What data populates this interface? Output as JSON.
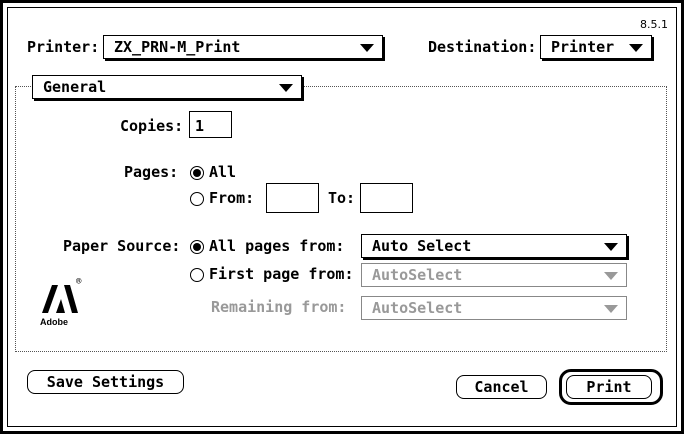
{
  "version": "8.5.1",
  "printer": {
    "label": "Printer:",
    "value": "ZX_PRN-M_Print"
  },
  "destination": {
    "label": "Destination:",
    "value": "Printer"
  },
  "panel": {
    "value": "General"
  },
  "copies": {
    "label": "Copies:",
    "value": "1"
  },
  "pages": {
    "label": "Pages:",
    "all_label": "All",
    "from_label": "From:",
    "to_label": "To:",
    "from_value": "",
    "to_value": "",
    "selected": "All"
  },
  "paper_source": {
    "label": "Paper Source:",
    "all_pages_label": "All pages from:",
    "all_pages_value": "Auto Select",
    "first_page_label": "First page from:",
    "first_page_value": "AutoSelect",
    "remaining_label": "Remaining from:",
    "remaining_value": "AutoSelect",
    "selected": "All pages from:"
  },
  "logo": {
    "text": "Adobe",
    "mark": "®"
  },
  "buttons": {
    "save": "Save Settings",
    "cancel": "Cancel",
    "print": "Print"
  }
}
